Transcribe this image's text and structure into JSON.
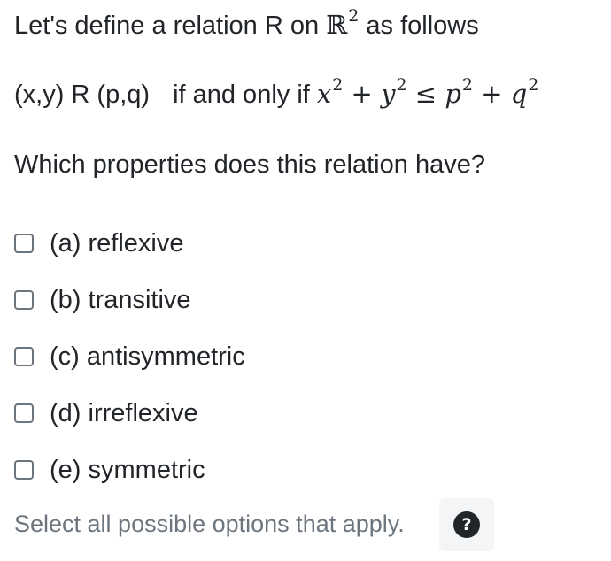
{
  "question": {
    "line1_prefix": "Let's define a relation R on ",
    "line1_set": "ℝ",
    "line1_set_exponent": "2",
    "line1_suffix": " as follows",
    "line2_relation": "(x,y) R (p,q)",
    "line2_connective": "if and only if",
    "condition": {
      "t1": "x",
      "e1": "2",
      "op1": " + ",
      "t2": "y",
      "e2": "2",
      "rel": " ≤ ",
      "t3": "p",
      "e3": "2",
      "op2": " + ",
      "t4": "q",
      "e4": "2"
    },
    "line3": "Which properties does this relation have?"
  },
  "options": [
    {
      "label": "(a) reflexive",
      "checked": false
    },
    {
      "label": "(b) transitive",
      "checked": false
    },
    {
      "label": "(c) antisymmetric",
      "checked": false
    },
    {
      "label": "(d) irreflexive",
      "checked": false
    },
    {
      "label": "(e) symmetric",
      "checked": false
    }
  ],
  "hint": "Select all possible options that apply.",
  "help": {
    "icon": "question-mark-icon",
    "glyph": "?"
  },
  "colors": {
    "text": "#212529",
    "muted": "#6c757d",
    "help_bg": "#f4f5f7"
  }
}
